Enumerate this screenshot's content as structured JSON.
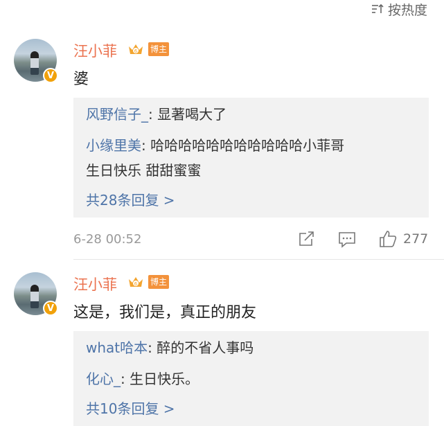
{
  "sort": {
    "label": "按热度"
  },
  "comments": [
    {
      "username": "汪小菲",
      "badge": "博主",
      "verified_mark": "V",
      "text": "婆",
      "replies": [
        {
          "name": "风野信子_",
          "sep": ": ",
          "text": "显著喝大了"
        },
        {
          "name": "小缘里美",
          "sep": ": ",
          "text": "哈哈哈哈哈哈哈哈哈哈哈小菲哥",
          "text2": "生日快乐 甜甜蜜蜜"
        }
      ],
      "more_replies": "共28条回复 >",
      "time": "6-28 00:52",
      "likes": "277"
    },
    {
      "username": "汪小菲",
      "badge": "博主",
      "verified_mark": "V",
      "text": "这是，我们是，真正的朋友",
      "replies": [
        {
          "name": "what哈本",
          "sep": ": ",
          "text": "醉的不省人事吗"
        },
        {
          "name": "化心_",
          "sep": ": ",
          "text": "生日快乐。"
        }
      ],
      "more_replies": "共10条回复 >"
    }
  ],
  "colors": {
    "username": "#eb7350",
    "reply_name": "#4e74a8",
    "badge": "#f3923b",
    "verified": "#f1a10b"
  }
}
